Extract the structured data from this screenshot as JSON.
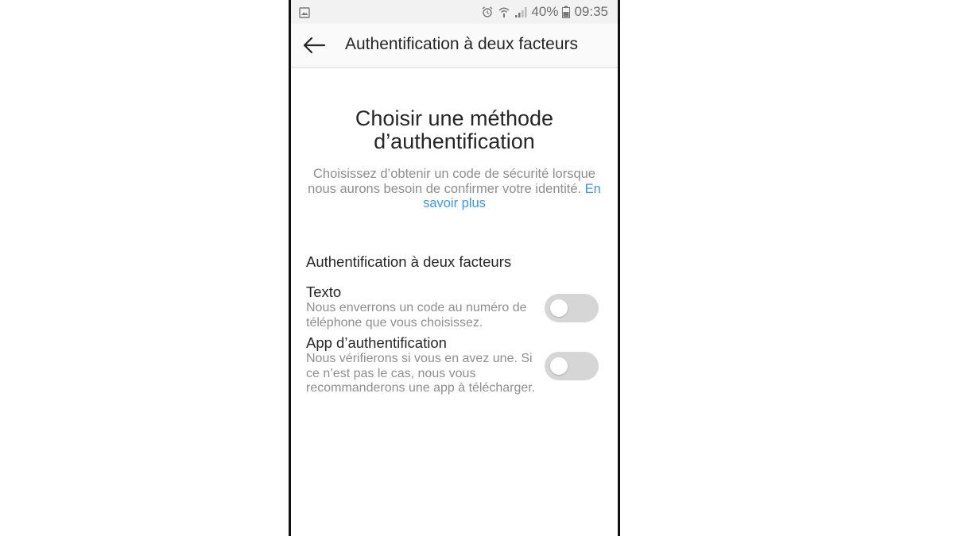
{
  "status_bar": {
    "left_icon": "image-notification-icon",
    "icons": [
      "alarm-icon",
      "wifi-icon",
      "signal-icon",
      "battery-icon"
    ],
    "battery": "40%",
    "time": "09:35"
  },
  "app_bar": {
    "back_icon": "arrow-left-icon",
    "title": "Authentification à deux facteurs"
  },
  "main": {
    "heading_line1": "Choisir une méthode",
    "heading_line2": "d’authentification",
    "description": "Choisissez d’obtenir un code de sécurité lorsque nous aurons besoin de confirmer votre identité. ",
    "learn_more": "En savoir plus",
    "section_title": "Authentification à deux facteurs",
    "options": [
      {
        "label": "Texto",
        "description": "Nous enverrons un code au numéro de téléphone que vous choisissez.",
        "enabled": false
      },
      {
        "label": "App d’authentification",
        "description": "Nous vérifierons si vous en avez une. Si ce n’est pas le cas, nous vous recommanderons une app à télécharger.",
        "enabled": false
      }
    ]
  },
  "colors": {
    "link": "#3897f0",
    "text_primary": "#262626",
    "text_secondary": "#8e8e8e",
    "toggle_off": "#d6d6d6"
  }
}
